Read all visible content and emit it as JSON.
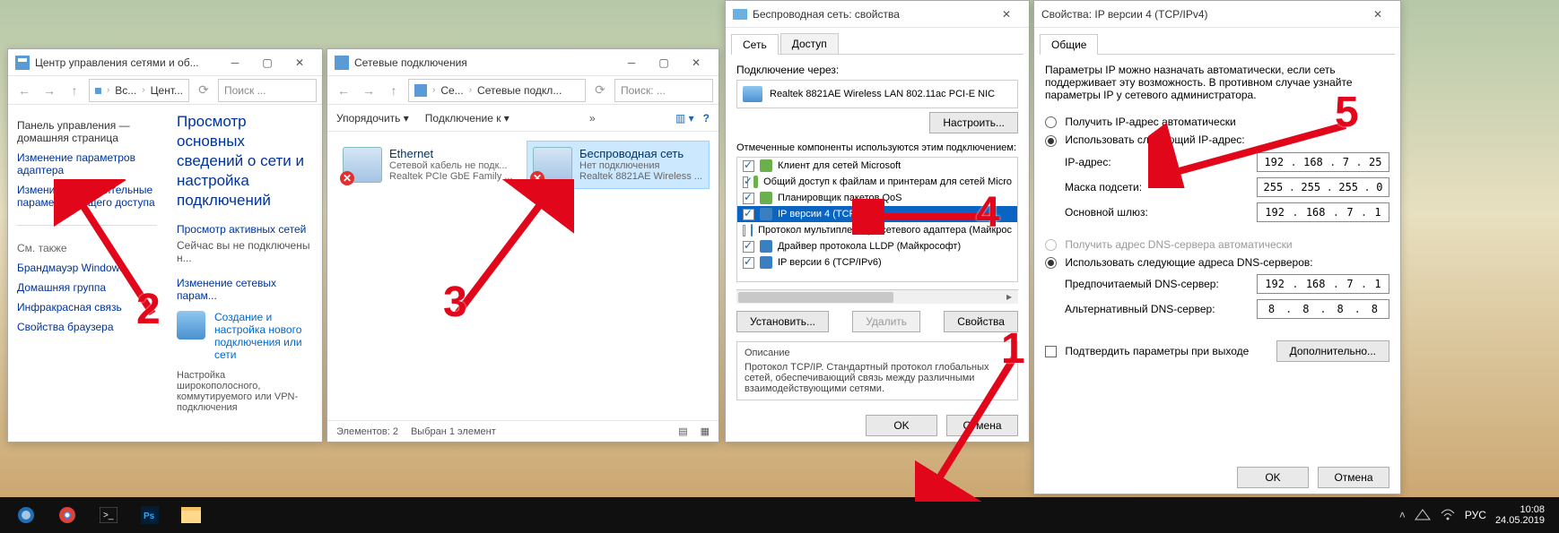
{
  "win1": {
    "title": "Центр управления сетями и об...",
    "search_ph": "Поиск ...",
    "crumbs": [
      "Вс...",
      "Цент..."
    ],
    "heading": "Просмотр основных сведений о сети и настройка подключений",
    "side_links": {
      "home": "Панель управления — домашняя страница",
      "adapter": "Изменение параметров адаптера",
      "sharing": "Изменить дополнительные параметры общего доступа"
    },
    "see_also_h": "См. также",
    "see_also": [
      "Брандмауэр Windows",
      "Домашняя группа",
      "Инфракрасная связь",
      "Свойства браузера"
    ],
    "sub1": "Просмотр активных сетей",
    "sub1_txt": "Сейчас вы не подключены н...",
    "sub2": "Изменение сетевых парам...",
    "task1_link": "Создание и настройка нового подключения или сети",
    "task2_desc": "Настройка широкополосного, коммутируемого или VPN-подключения"
  },
  "win2": {
    "title": "Сетевые подключения",
    "crumbs": [
      "Се...",
      "Сетевые подкл..."
    ],
    "search_ph": "Поиск: ...",
    "tb_org": "Упорядочить",
    "tb_conn": "Подключение к",
    "items": [
      {
        "name": "Ethernet",
        "l2": "Сетевой кабель не подк...",
        "l3": "Realtek PCIe GbE Family ..."
      },
      {
        "name": "Беспроводная сеть",
        "l2": "Нет подключения",
        "l3": "Realtek 8821AE Wireless ..."
      }
    ],
    "status_count": "Элементов: 2",
    "status_sel": "Выбран 1 элемент"
  },
  "win3": {
    "title": "Беспроводная сеть: свойства",
    "tabs": [
      "Сеть",
      "Доступ"
    ],
    "conn_via_lbl": "Подключение через:",
    "device": "Realtek 8821AE Wireless LAN 802.11ac PCI-E NIC",
    "configure": "Настроить...",
    "comp_lbl": "Отмеченные компоненты используются этим подключением:",
    "components": [
      {
        "t": "Клиент для сетей Microsoft",
        "c": true
      },
      {
        "t": "Общий доступ к файлам и принтерам для сетей Micro",
        "c": true
      },
      {
        "t": "Планировщик пакетов QoS",
        "c": true
      },
      {
        "t": "IP версии 4 (TCP/IPv4)",
        "c": true,
        "sel": true
      },
      {
        "t": "Протокол мультиплексора сетевого адаптера (Майкрос",
        "c": false
      },
      {
        "t": "Драйвер протокола LLDP (Майкрософт)",
        "c": true
      },
      {
        "t": "IP версии 6 (TCP/IPv6)",
        "c": true
      }
    ],
    "btn_install": "Установить...",
    "btn_remove": "Удалить",
    "btn_props": "Свойства",
    "desc_h": "Описание",
    "desc_t": "Протокол TCP/IP. Стандартный протокол глобальных сетей, обеспечивающий связь между различными взаимодействующими сетями.",
    "ok": "OK",
    "cancel": "Отмена"
  },
  "win4": {
    "title": "Свойства: IP версии 4 (TCP/IPv4)",
    "tab": "Общие",
    "intro": "Параметры IP можно назначать автоматически, если сеть поддерживает эту возможность. В противном случае узнайте параметры IP у сетевого администратора.",
    "r_auto_ip": "Получить IP-адрес автоматически",
    "r_man_ip": "Использовать следующий IP-адрес:",
    "f_ip": "IP-адрес:",
    "v_ip": [
      "192",
      "168",
      "7",
      "25"
    ],
    "f_mask": "Маска подсети:",
    "v_mask": [
      "255",
      "255",
      "255",
      "0"
    ],
    "f_gw": "Основной шлюз:",
    "v_gw": [
      "192",
      "168",
      "7",
      "1"
    ],
    "r_auto_dns": "Получить адрес DNS-сервера автоматически",
    "r_man_dns": "Использовать следующие адреса DNS-серверов:",
    "f_dns1": "Предпочитаемый DNS-сервер:",
    "v_dns1": [
      "192",
      "168",
      "7",
      "1"
    ],
    "f_dns2": "Альтернативный DNS-сервер:",
    "v_dns2": [
      "8",
      "8",
      "8",
      "8"
    ],
    "chk_validate": "Подтвердить параметры при выходе",
    "btn_adv": "Дополнительно...",
    "ok": "OK",
    "cancel": "Отмена"
  },
  "taskbar": {
    "lang": "РУС",
    "time": "10:08",
    "date": "24.05.2019"
  },
  "annot": {
    "n1": "1",
    "n2": "2",
    "n3": "3",
    "n4": "4",
    "n5": "5"
  }
}
